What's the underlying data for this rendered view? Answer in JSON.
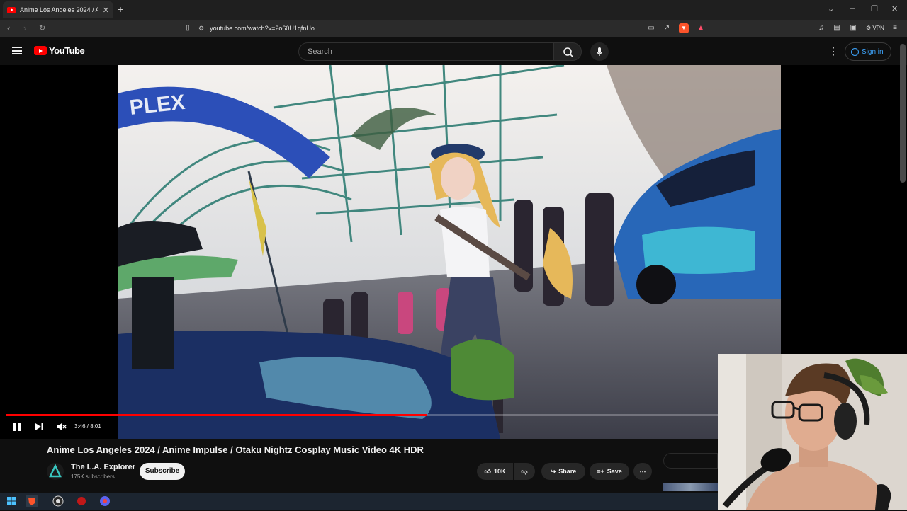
{
  "browser": {
    "tab_title": "Anime Los Angeles 2024 / Anim",
    "url": "youtube.com/watch?v=2o60U1qfnUo",
    "vpn_label": "VPN"
  },
  "youtube": {
    "logo_text": "YouTube",
    "search_placeholder": "Search",
    "signin_label": "Sign in"
  },
  "player": {
    "time_current": "3:46",
    "time_total": "8:01",
    "time_display": "3:46 / 8:01",
    "progress_fraction": 0.47,
    "state": "playing",
    "muted": true
  },
  "video": {
    "title": "Anime Los Angeles 2024 / Anime Impulse / Otaku Nightz Cosplay Music Video 4K HDR",
    "channel_name": "The L.A. Explorer",
    "subscriber_count": "175K subscribers",
    "subscribe_label": "Subscribe",
    "like_count": "10K",
    "share_label": "Share",
    "save_label": "Save"
  },
  "scene": {
    "sign_text": "PLEX"
  },
  "colors": {
    "accent": "#ff0000",
    "link": "#3ea6ff",
    "background": "#0f0f0f"
  },
  "icons": {
    "tab_favicon": "youtube-icon",
    "search": "search-icon",
    "mic": "mic-icon",
    "signin": "person-icon",
    "pause": "pause-icon",
    "next": "next-icon",
    "volume": "volume-muted-icon"
  }
}
